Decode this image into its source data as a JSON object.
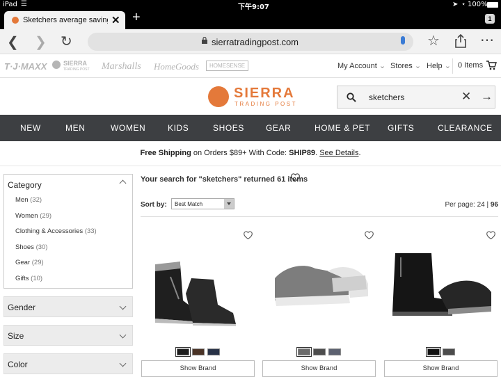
{
  "status_bar": {
    "device": "iPad",
    "time": "下午9:07",
    "battery": "100%"
  },
  "browser": {
    "tab_title": "Sketchers average savings",
    "tab_count": "1",
    "url": "sierratradingpost.com"
  },
  "retailers": {
    "logos": [
      "T·J·MAXX",
      "SIERRA",
      "Marshalls",
      "HomeGoods",
      "HOMESENSE"
    ],
    "sierra_sub": "TRADING POST",
    "links": {
      "account": "My Account",
      "stores": "Stores",
      "help": "Help",
      "cart": "0 Items"
    }
  },
  "header": {
    "brand_name": "SIERRA",
    "brand_sub": "TRADING POST",
    "search_value": "sketchers"
  },
  "nav": [
    "NEW",
    "MEN",
    "WOMEN",
    "KIDS",
    "SHOES",
    "GEAR",
    "HOME & PET",
    "GIFTS",
    "CLEARANCE"
  ],
  "promo": {
    "strong1": "Free Shipping",
    "text1": " on Orders $89+ With Code: ",
    "code": "SHIP89",
    "text2": ". ",
    "link": "See Details",
    "text3": "."
  },
  "filters": {
    "category": {
      "title": "Category",
      "options": [
        {
          "label": "Men",
          "count": "(32)"
        },
        {
          "label": "Women",
          "count": "(29)"
        },
        {
          "label": "Clothing & Accessories",
          "count": "(33)"
        },
        {
          "label": "Shoes",
          "count": "(30)"
        },
        {
          "label": "Gear",
          "count": "(29)"
        },
        {
          "label": "Gifts",
          "count": "(10)"
        }
      ]
    },
    "collapsed": [
      "Gender",
      "Size",
      "Color"
    ]
  },
  "results": {
    "heading": "Your search for \"sketchers\" returned 61 items",
    "sort_label": "Sort by:",
    "sort_value": "Best Match",
    "per_page_label": "Per page: 24 | ",
    "per_page_alt": "96"
  },
  "products": [
    {
      "swatches": [
        "#1d1d1d",
        "#4a3326",
        "#283247"
      ],
      "button": "Show Brand"
    },
    {
      "swatches": [
        "#6b6b6b",
        "#4d4d4d",
        "#5c6170"
      ],
      "button": "Show Brand"
    },
    {
      "swatches": [
        "#111111",
        "#4b4b4b"
      ],
      "button": "Show Brand"
    }
  ]
}
